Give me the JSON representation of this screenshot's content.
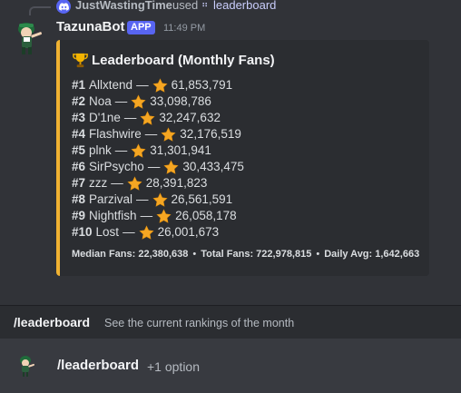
{
  "interaction": {
    "user": "JustWastingTime",
    "used_text": "used",
    "command": "leaderboard"
  },
  "message": {
    "author": "TazunaBot",
    "badge": "APP",
    "timestamp": "11:49 PM"
  },
  "embed": {
    "accent_color": "#f0b232",
    "title": "Leaderboard (Monthly Fans)",
    "title_icon": "trophy-icon",
    "entries": [
      {
        "rank": "#1",
        "name": "Allxtend",
        "fans": "61,853,791"
      },
      {
        "rank": "#2",
        "name": "Noa",
        "fans": "33,098,786"
      },
      {
        "rank": "#3",
        "name": "D'1ne",
        "fans": "32,247,632"
      },
      {
        "rank": "#4",
        "name": "Flashwire",
        "fans": "32,176,519"
      },
      {
        "rank": "#5",
        "name": "plnk",
        "fans": "31,301,941"
      },
      {
        "rank": "#6",
        "name": "SirPsycho",
        "fans": "30,433,475"
      },
      {
        "rank": "#7",
        "name": "zzz",
        "fans": "28,391,823"
      },
      {
        "rank": "#8",
        "name": "Parzival",
        "fans": "26,561,591"
      },
      {
        "rank": "#9",
        "name": "Nightfish",
        "fans": "26,058,178"
      },
      {
        "rank": "#10",
        "name": "Lost",
        "fans": "26,001,673"
      }
    ],
    "separator": "—",
    "stats": {
      "median": "Median Fans: 22,380,638",
      "total": "Total Fans: 722,978,815",
      "daily": "Daily Avg: 1,642,663",
      "dot": "•"
    }
  },
  "command_hint": {
    "name": "/leaderboard",
    "description": "See the current rankings of the month"
  },
  "command_row": {
    "name": "/leaderboard",
    "options": "+1 option"
  }
}
